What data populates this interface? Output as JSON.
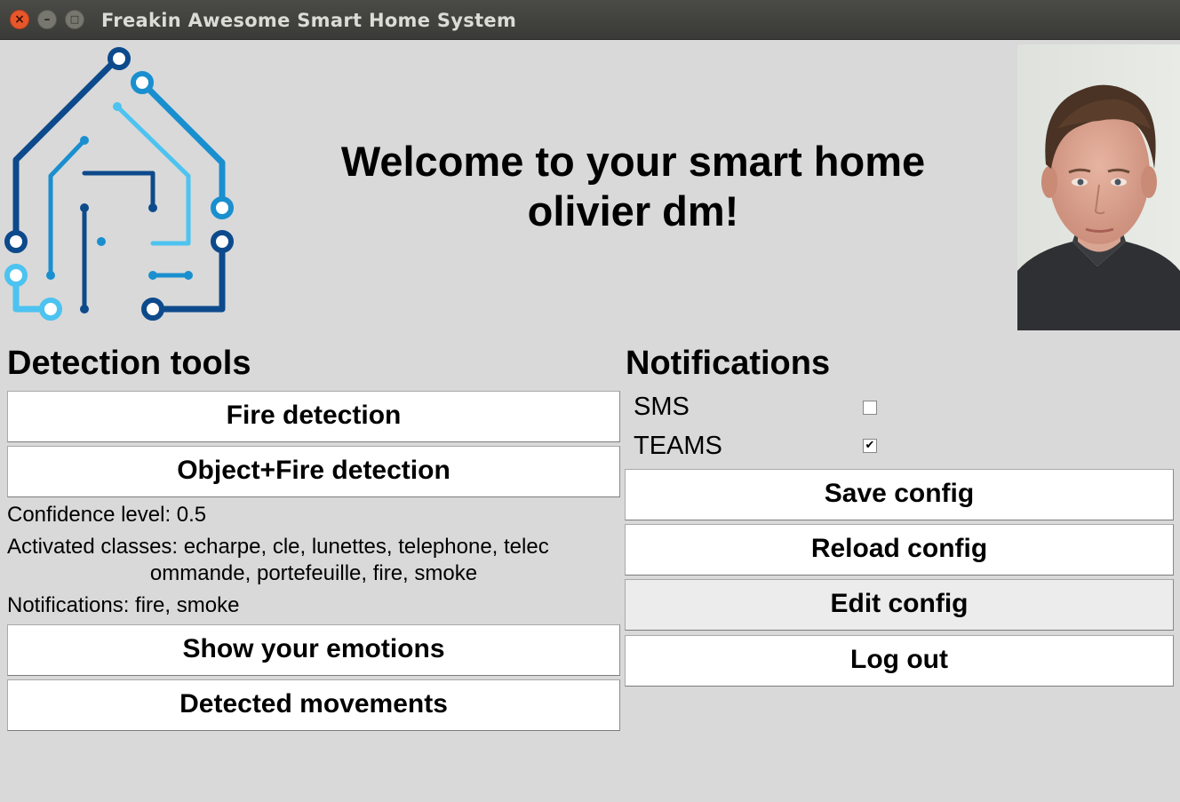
{
  "window": {
    "title": "Freakin Awesome Smart Home System",
    "close_glyph": "×",
    "minimize_glyph": "–",
    "maximize_glyph": "□"
  },
  "welcome": {
    "line1": "Welcome to your smart home",
    "line2": "olivier dm!"
  },
  "detection": {
    "heading": "Detection tools",
    "fire_button": "Fire detection",
    "object_fire_button": "Object+Fire detection",
    "confidence": "Confidence level: 0.5",
    "classes_line1": "Activated classes: echarpe, cle, lunettes, telephone, telec",
    "classes_line2": "ommande, portefeuille, fire, smoke",
    "notifications": "Notifications: fire, smoke",
    "emotions_button": "Show your emotions",
    "movements_button": "Detected movements"
  },
  "notifications": {
    "heading": "Notifications",
    "sms_label": "SMS",
    "sms_checked": false,
    "teams_label": "TEAMS",
    "teams_checked": true,
    "check_glyph": "✔",
    "save_button": "Save config",
    "reload_button": "Reload config",
    "edit_button": "Edit config",
    "logout_button": "Log out"
  },
  "colors": {
    "logo_dark": "#0d4a8c",
    "logo_mid": "#1a8fcf",
    "logo_light": "#4cc3f0",
    "background": "#d9d9d9"
  },
  "icons": {
    "logo": "smart-home-circuit-logo",
    "photo": "user-avatar-photo"
  }
}
